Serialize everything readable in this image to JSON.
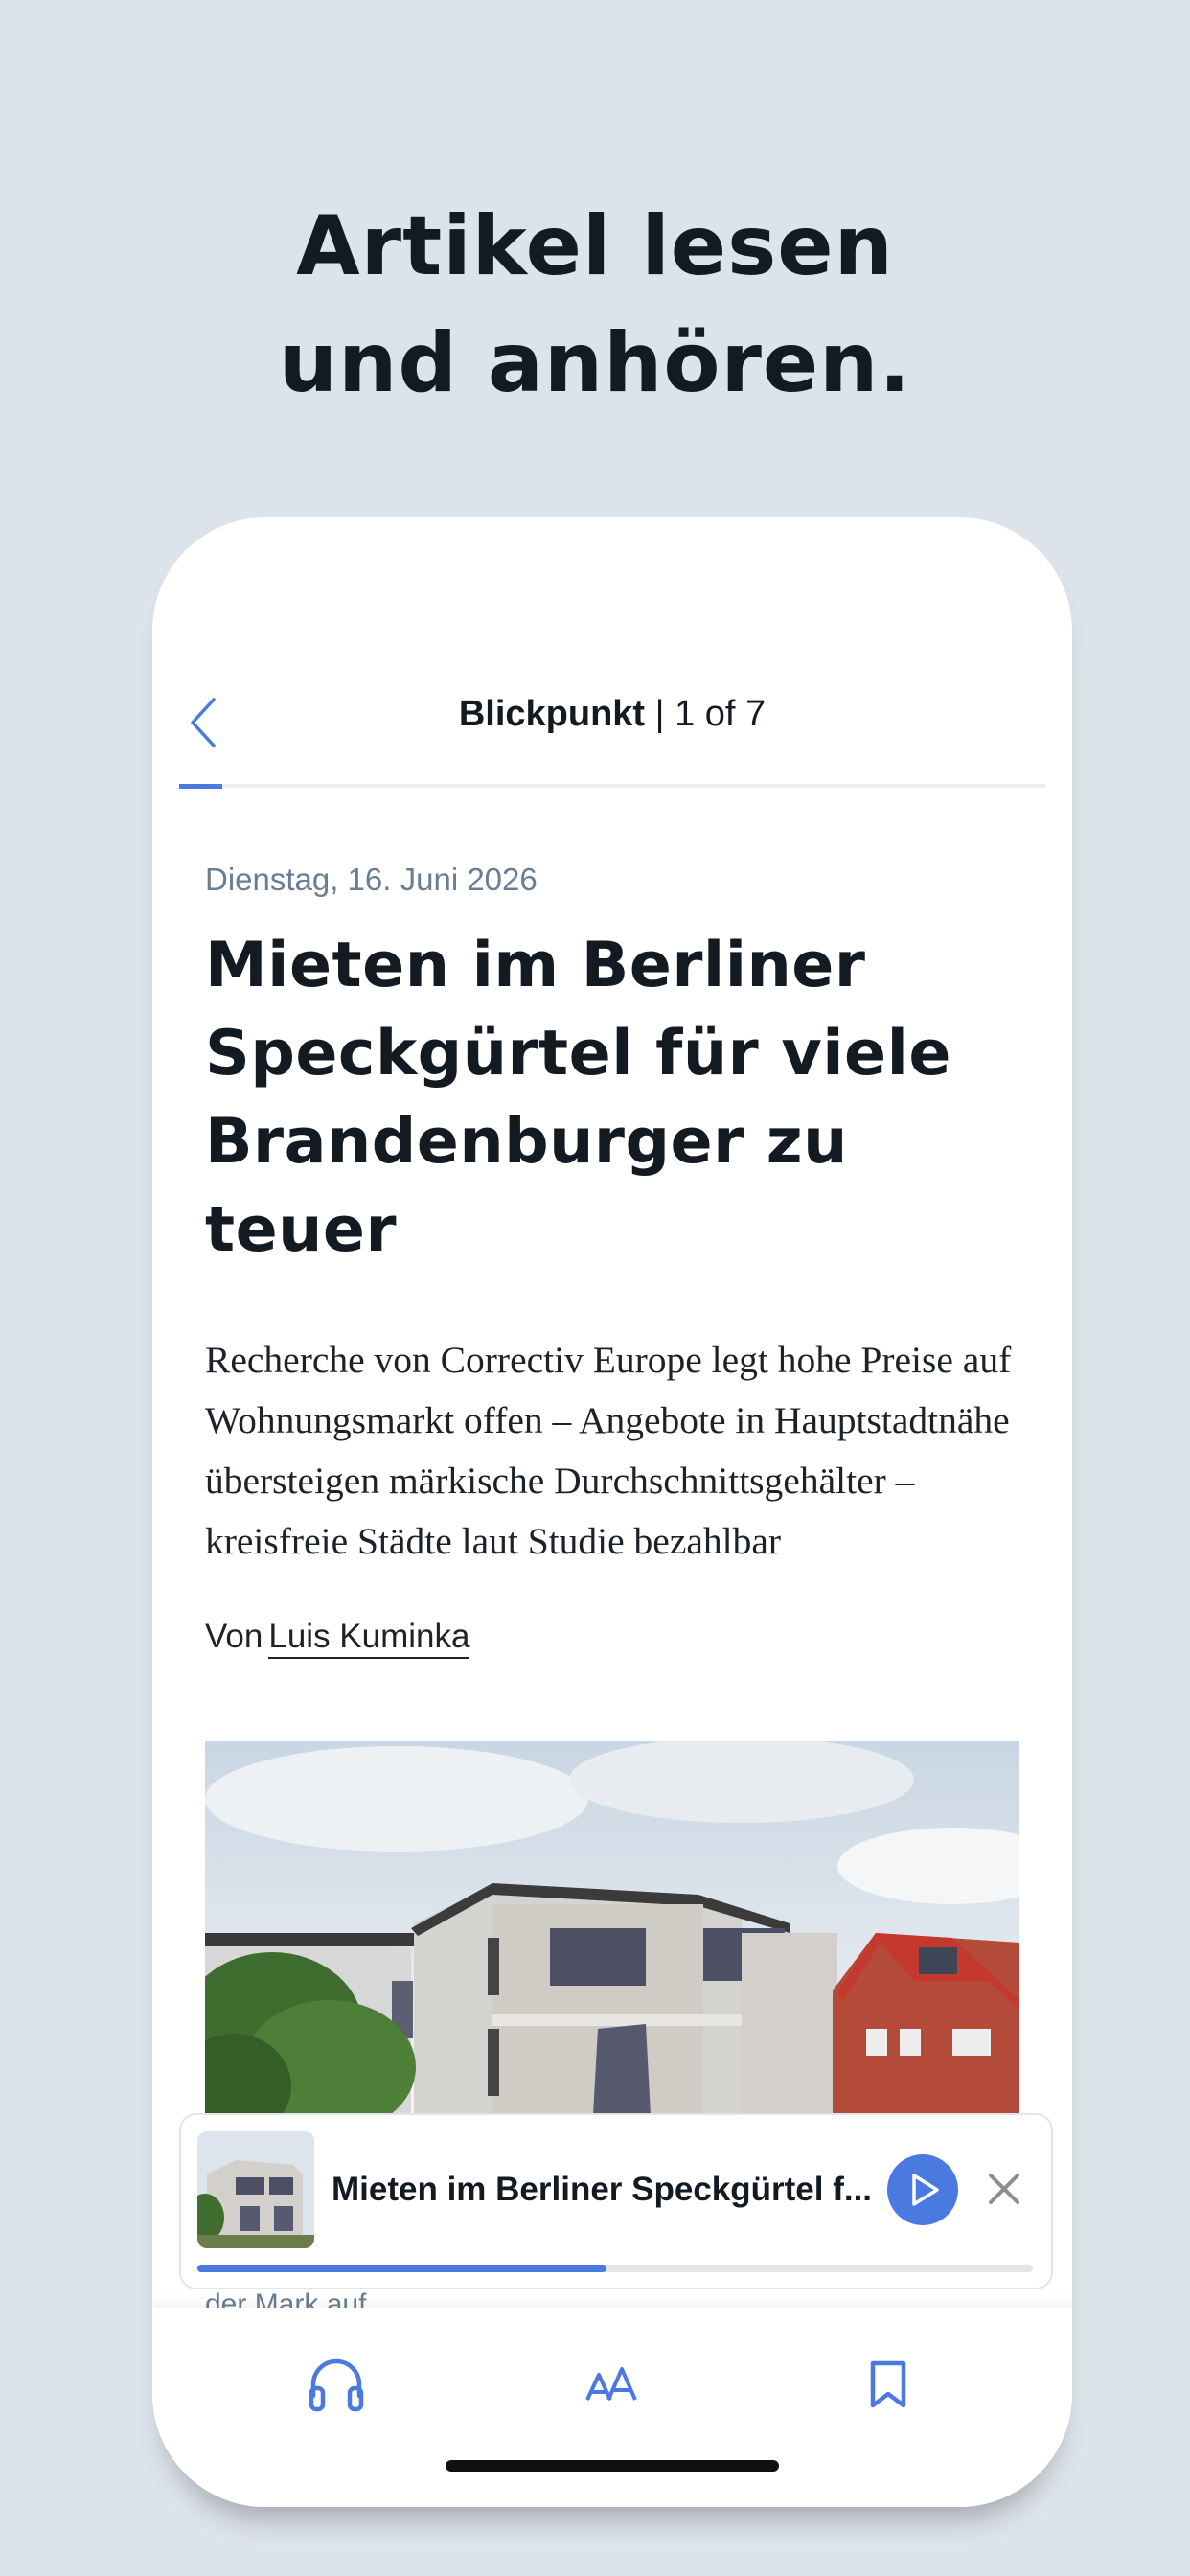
{
  "promo": {
    "headline_line1": "Artikel lesen",
    "headline_line2": "und anhören."
  },
  "nav": {
    "section": "Blickpunkt",
    "position": "| 1 of 7",
    "progress": 0.05,
    "accent_color": "#4a7ae0"
  },
  "article": {
    "date": "Dienstag, 16. Juni 2026",
    "title": "Mieten im Berliner Speckgürtel für viele Brandenburger zu teuer",
    "lead": "Recherche von Correctiv Europe legt hohe Preise auf Wohnungsmarkt offen – Angebote in Hauptstadtnähe übersteigen märkische Durchschnittsgehälter – kreisfreie Städte laut Studie bezahlbar",
    "byline_prefix": "Von",
    "author": "Luis Kuminka",
    "next_text_fragment": "der Mark auf"
  },
  "player": {
    "title": "Mieten im Berliner Speckgürtel f...",
    "progress": 0.49,
    "play_icon": "play-icon",
    "close_icon": "close-icon"
  },
  "tabbar": {
    "items": [
      {
        "icon": "headphones-icon"
      },
      {
        "icon": "text-size-icon"
      },
      {
        "icon": "bookmark-icon"
      }
    ]
  }
}
